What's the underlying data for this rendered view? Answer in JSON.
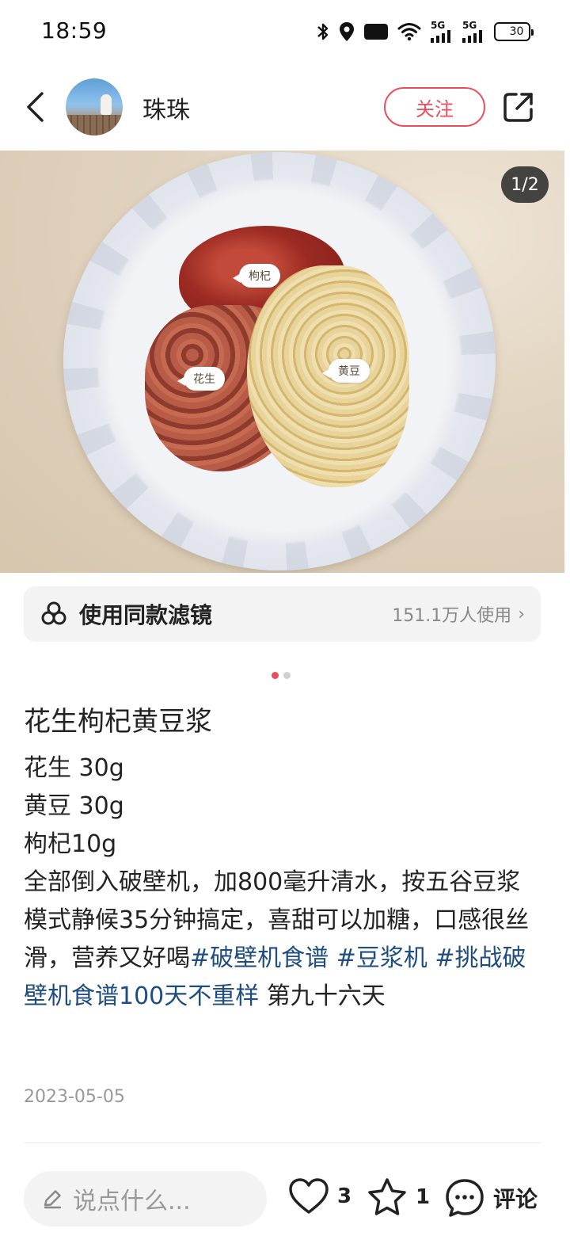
{
  "status_bar": {
    "time": "18:59",
    "icons": [
      "bluetooth-icon",
      "location-icon",
      "hd-icon",
      "wifi-icon",
      "5g-signal-icon",
      "5g-signal-icon",
      "battery-icon"
    ],
    "hd_label": "HD",
    "signal_label_1": "5G",
    "signal_label_2": "5G",
    "battery": "30",
    "battery_level": 0.3
  },
  "header": {
    "username": "珠珠",
    "follow_label": "关注"
  },
  "photo": {
    "counter": "1/2",
    "tags": {
      "goji": "枸杞",
      "peanut": "花生",
      "soy": "黄豆"
    }
  },
  "filter": {
    "label": "使用同款滤镜",
    "count": "151.1万人使用",
    "arrow": "›"
  },
  "carousel": {
    "total": 2,
    "active": 1
  },
  "post": {
    "title": "花生枸杞黄豆浆",
    "lines": [
      "花生 30g",
      "黄豆 30g",
      "枸杞10g"
    ],
    "body_text": "全部倒入破壁机，加800毫升清水，按五谷豆浆模式静候35分钟搞定，喜甜可以加糖，口感很丝滑，营养又好喝",
    "hashtag_1": "#破壁机食谱",
    "hashtag_2": "#豆浆机",
    "hashtag_3": "#挑战破壁机食谱100天不重样",
    "suffix": "第九十六天",
    "date": "2023-05-05"
  },
  "bottom_bar": {
    "comment_placeholder": "说点什么...",
    "like_count": "3",
    "star_count": "1",
    "comment_label": "评论"
  },
  "colors": {
    "accent": "#ea4d5c",
    "hashtag": "#1f4d80",
    "muted": "#999999"
  }
}
